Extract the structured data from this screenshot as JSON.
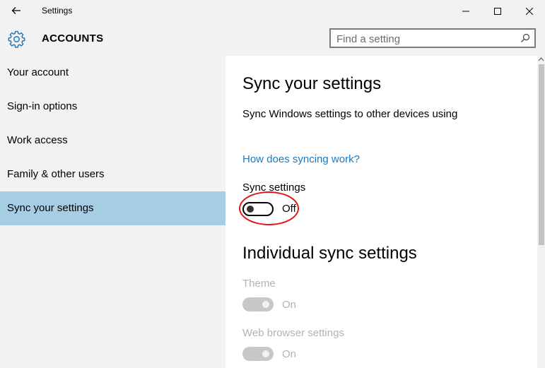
{
  "window": {
    "title": "Settings"
  },
  "header": {
    "section_title": "ACCOUNTS",
    "search_placeholder": "Find a setting"
  },
  "sidebar": {
    "items": [
      {
        "label": "Your account"
      },
      {
        "label": "Sign-in options"
      },
      {
        "label": "Work access"
      },
      {
        "label": "Family & other users"
      },
      {
        "label": "Sync your settings",
        "active": true
      }
    ]
  },
  "main": {
    "title": "Sync your settings",
    "description": "Sync Windows settings to other devices using",
    "help_link": "How does syncing work?",
    "sync_settings": {
      "label": "Sync settings",
      "state": "Off"
    },
    "individual_title": "Individual sync settings",
    "individual_items": [
      {
        "label": "Theme",
        "state": "On"
      },
      {
        "label": "Web browser settings",
        "state": "On"
      }
    ]
  },
  "colors": {
    "accent_link": "#1a79c1",
    "active_nav": "#a7cde5",
    "highlight_annotation": "#e0151b",
    "disabled_text": "#b3b3b3"
  },
  "icons": [
    "back-arrow-icon",
    "minimize-icon",
    "maximize-icon",
    "close-icon",
    "gear-icon",
    "search-icon"
  ]
}
